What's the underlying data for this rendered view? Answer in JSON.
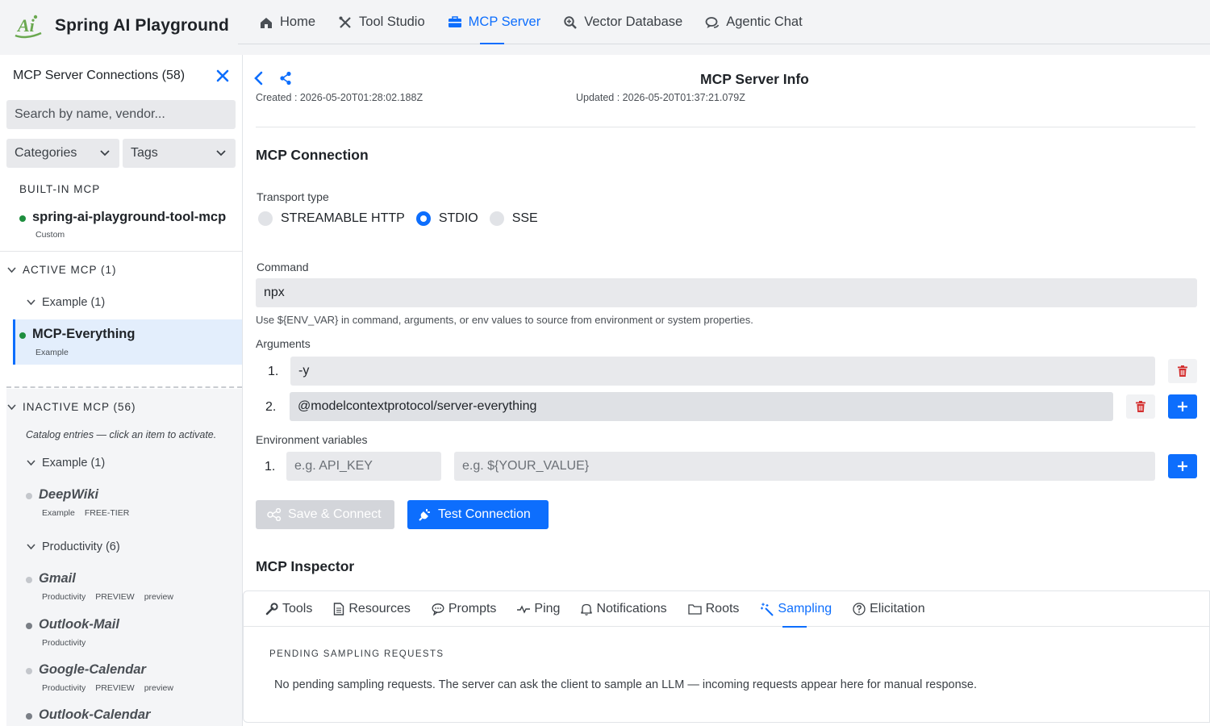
{
  "app": {
    "title": "Spring AI Playground",
    "logo_text": "Ai"
  },
  "nav": {
    "tabs": [
      {
        "label": "Home",
        "icon": "home-icon"
      },
      {
        "label": "Tool Studio",
        "icon": "tools-icon"
      },
      {
        "label": "MCP Server",
        "icon": "server-icon",
        "active": true
      },
      {
        "label": "Vector Database",
        "icon": "search-zoom-icon"
      },
      {
        "label": "Agentic Chat",
        "icon": "chat-icon"
      }
    ]
  },
  "sidebar": {
    "title": "MCP Server Connections (58)",
    "search_placeholder": "Search by name, vendor...",
    "categories_label": "Categories",
    "tags_label": "Tags",
    "builtin": {
      "label": "BUILT-IN MCP",
      "items": [
        {
          "name": "spring-ai-playground-tool-mcp",
          "tags": [
            "Custom"
          ],
          "status": "connected"
        }
      ]
    },
    "active": {
      "label": "ACTIVE MCP (1)",
      "group_label": "Example (1)",
      "items": [
        {
          "name": "MCP-Everything",
          "tags": [
            "Example"
          ],
          "status": "connected",
          "selected": true
        }
      ]
    },
    "inactive": {
      "label": "INACTIVE MCP (56)",
      "note": "Catalog entries — click an item to activate.",
      "groups": [
        {
          "label": "Example (1)",
          "items": [
            {
              "name": "DeepWiki",
              "tags": [
                "Example",
                "FREE-TIER"
              ]
            }
          ]
        },
        {
          "label": "Productivity (6)",
          "items": [
            {
              "name": "Gmail",
              "tags": [
                "Productivity",
                "PREVIEW",
                "preview"
              ]
            },
            {
              "name": "Outlook-Mail",
              "tags": [
                "Productivity"
              ]
            },
            {
              "name": "Google-Calendar",
              "tags": [
                "Productivity",
                "PREVIEW",
                "preview"
              ]
            },
            {
              "name": "Outlook-Calendar",
              "tags": []
            }
          ]
        }
      ]
    }
  },
  "main": {
    "title": "MCP Server Info",
    "created": "Created : 2026-05-20T01:28:02.188Z",
    "updated": "Updated : 2026-05-20T01:37:21.079Z",
    "connection": {
      "heading": "MCP Connection",
      "transport_label": "Transport type",
      "transport_options": [
        "STREAMABLE HTTP",
        "STDIO",
        "SSE"
      ],
      "transport_selected": "STDIO",
      "command_label": "Command",
      "command_value": "npx",
      "hint": "Use ${ENV_VAR} in command, arguments, or env values to source from environment or system properties.",
      "arguments_label": "Arguments",
      "arguments": [
        {
          "index": "1.",
          "value": "-y"
        },
        {
          "index": "2.",
          "value": "@modelcontextprotocol/server-everything"
        }
      ],
      "env_label": "Environment variables",
      "env": [
        {
          "index": "1.",
          "key_placeholder": "e.g. API_KEY",
          "value_placeholder": "e.g. ${YOUR_VALUE}"
        }
      ],
      "save_label": "Save & Connect",
      "test_label": "Test Connection"
    },
    "inspector": {
      "heading": "MCP Inspector",
      "tabs": [
        {
          "label": "Tools",
          "icon": "wrench-icon"
        },
        {
          "label": "Resources",
          "icon": "document-icon"
        },
        {
          "label": "Prompts",
          "icon": "speech-bubble-icon"
        },
        {
          "label": "Ping",
          "icon": "pulse-icon"
        },
        {
          "label": "Notifications",
          "icon": "bell-icon"
        },
        {
          "label": "Roots",
          "icon": "folder-icon"
        },
        {
          "label": "Sampling",
          "icon": "magic-wand-icon",
          "active": true
        },
        {
          "label": "Elicitation",
          "icon": "question-circle-icon"
        }
      ],
      "pending_label": "PENDING SAMPLING REQUESTS",
      "pending_message": "No pending sampling requests. The server can ask the client to sample an LLM — incoming requests appear here for manual response."
    }
  },
  "colors": {
    "accent": "#0d6efd",
    "connected": "#1e8e3e",
    "inactive_dot": "#c4c7cc",
    "danger": "#d32f2f"
  }
}
